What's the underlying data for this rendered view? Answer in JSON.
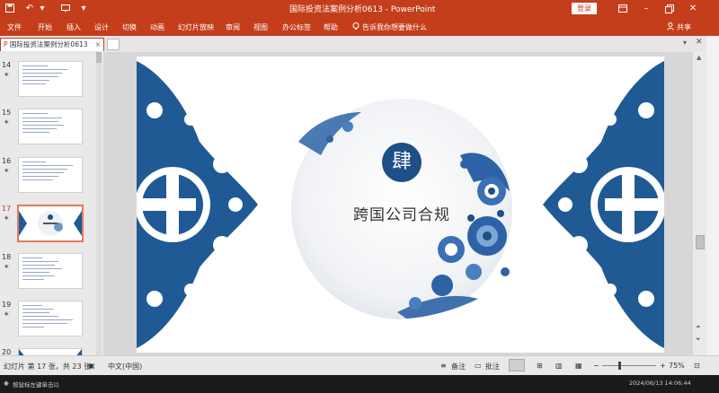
{
  "titlebar": {
    "save_icon": "save-icon",
    "undo_icon": "undo-icon",
    "window_title": "国际投资法案例分析0613  -  PowerPoint",
    "login_label": "登录",
    "restore_icon": "restore-icon"
  },
  "ribbon": {
    "tabs": [
      "文件",
      "开始",
      "插入",
      "设计",
      "切换",
      "动画",
      "幻灯片放映",
      "审阅",
      "视图",
      "办公标签",
      "帮助"
    ],
    "tellme": "告诉我你想要做什么",
    "share": "共享"
  },
  "doc_tab": {
    "label": "国际投资法案例分析0613",
    "close": "×"
  },
  "thumbnails": [
    {
      "num": "14"
    },
    {
      "num": "15"
    },
    {
      "num": "16"
    },
    {
      "num": "17",
      "selected": true
    },
    {
      "num": "18"
    },
    {
      "num": "19"
    },
    {
      "num": "20"
    }
  ],
  "slide": {
    "badge_char": "肆",
    "title": "跨国公司合规",
    "accent_color": "#1e4f86",
    "ornament_color": "#1f5a94"
  },
  "status": {
    "slide_counter": "幻灯片 第 17 张，共 23 张",
    "language": "中文(中国)",
    "notes": "备注",
    "comments": "批注",
    "zoom": "75%"
  },
  "taskbar": {
    "left_text": "按鼠标左键单击以",
    "right_text": "2024/06/13 14:06:44"
  }
}
